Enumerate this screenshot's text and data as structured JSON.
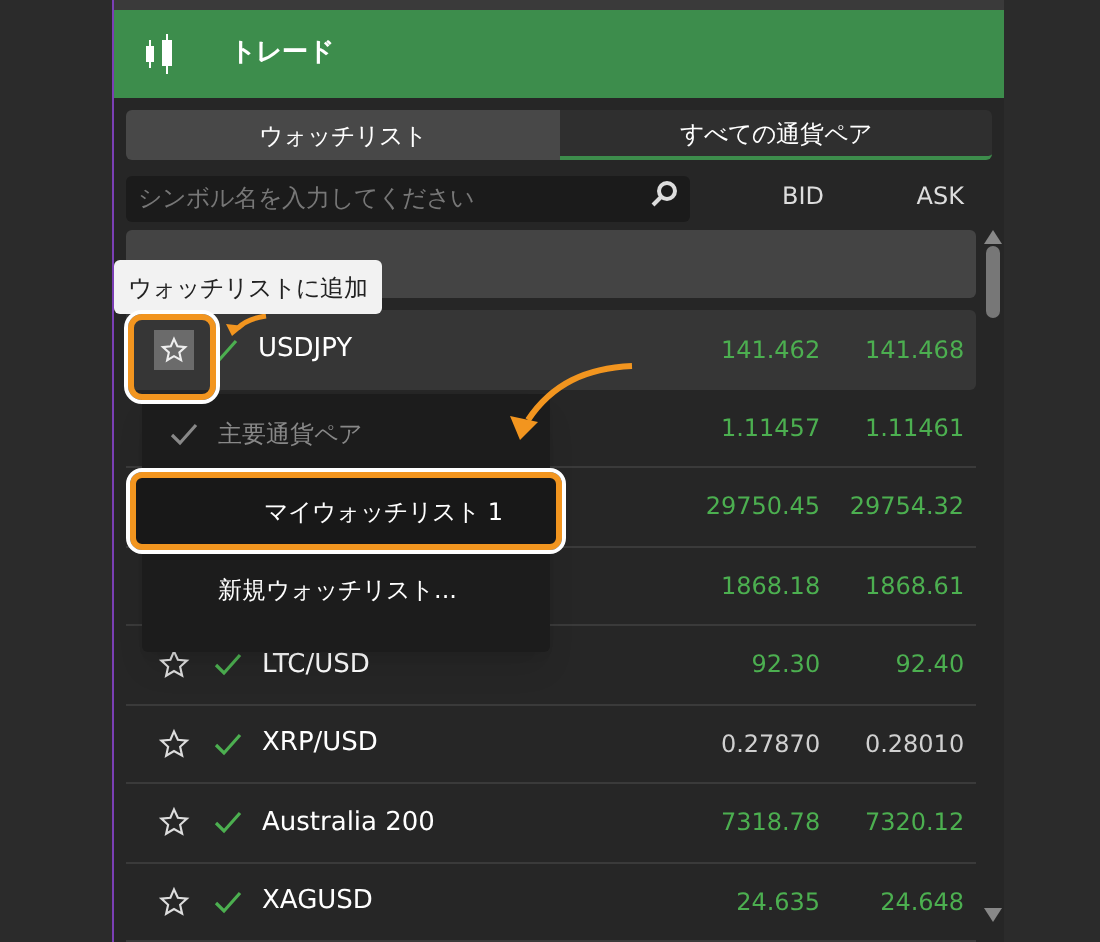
{
  "header": {
    "title": "トレード"
  },
  "tabs": [
    {
      "label": "ウォッチリスト",
      "selected": false
    },
    {
      "label": "すべての通貨ペア",
      "selected": true
    }
  ],
  "search": {
    "placeholder": "シンボル名を入力してください"
  },
  "columns": [
    "BID",
    "ASK"
  ],
  "tooltip": "ウォッチリストに追加",
  "rows": [
    {
      "name": "USDJPY",
      "bid": "141.462",
      "ask": "141.468",
      "color": "#4caf50",
      "selected": true
    },
    {
      "bid": "1.11457",
      "ask": "1.11461",
      "color": "#4caf50",
      "selected": false
    },
    {
      "bid": "29750.45",
      "ask": "29754.32",
      "color": "#4caf50",
      "selected": false
    },
    {
      "bid": "1868.18",
      "ask": "1868.61",
      "color": "#4caf50",
      "selected": false
    },
    {
      "name": "LTC/USD",
      "bid": "92.30",
      "ask": "92.40",
      "color": "#4caf50",
      "selected": false
    },
    {
      "name": "XRP/USD",
      "bid": "0.27870",
      "ask": "0.28010",
      "color": "#d0d0d0",
      "selected": false
    },
    {
      "name": "Australia 200",
      "bid": "7318.78",
      "ask": "7320.12",
      "color": "#4caf50",
      "selected": false
    },
    {
      "name": "XAGUSD",
      "bid": "24.635",
      "ask": "24.648",
      "color": "#4caf50",
      "selected": false
    }
  ],
  "menu": [
    {
      "label": "主要通貨ペア",
      "checked": true,
      "highlighted": false
    },
    {
      "label": "マイウォッチリスト 1",
      "checked": false,
      "highlighted": true
    },
    {
      "label": "新規ウォッチリスト...",
      "checked": false,
      "highlighted": false
    }
  ]
}
